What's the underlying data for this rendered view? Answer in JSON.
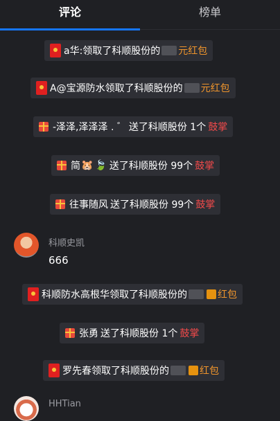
{
  "tabs": [
    {
      "label": "评论",
      "active": true
    },
    {
      "label": "榜单",
      "active": false
    }
  ],
  "feed": {
    "item1": {
      "user": "a华:",
      "action": "领取了科顺股份的",
      "suffix": "元红包"
    },
    "item2": {
      "user": "A@宝源防水",
      "action": "领取了科顺股份的",
      "suffix": "元红包"
    },
    "item3": {
      "user": "-泽泽,泽泽泽 . ゛",
      "action": "送了科顺股份 1个",
      "suffix": "鼓掌"
    },
    "item4": {
      "user": "简",
      "action": "送了科顺股份 99个",
      "suffix": "鼓掌"
    },
    "item5": {
      "user": "往事随风",
      "action": "送了科顺股份 99个",
      "suffix": "鼓掌"
    },
    "comment1": {
      "name": "科顺史凯",
      "text": "666"
    },
    "item6": {
      "user": "科顺防水高根华",
      "action": "领取了科顺股份的",
      "suffix": "红包"
    },
    "item7": {
      "user": "张勇",
      "action": "送了科顺股份 1个",
      "suffix": "鼓掌"
    },
    "item8": {
      "user": "罗先春",
      "action": "领取了科顺股份的",
      "suffix": "红包"
    },
    "comment2": {
      "name": "HHTian"
    }
  },
  "colors": {
    "accent": "#1677ff",
    "redpack_text": "#f0952c",
    "applause_text": "#f24a4a"
  },
  "icons": [
    "red-envelope-icon",
    "gift-icon",
    "hamster-emoji-icon",
    "leaf-emoji-icon"
  ]
}
